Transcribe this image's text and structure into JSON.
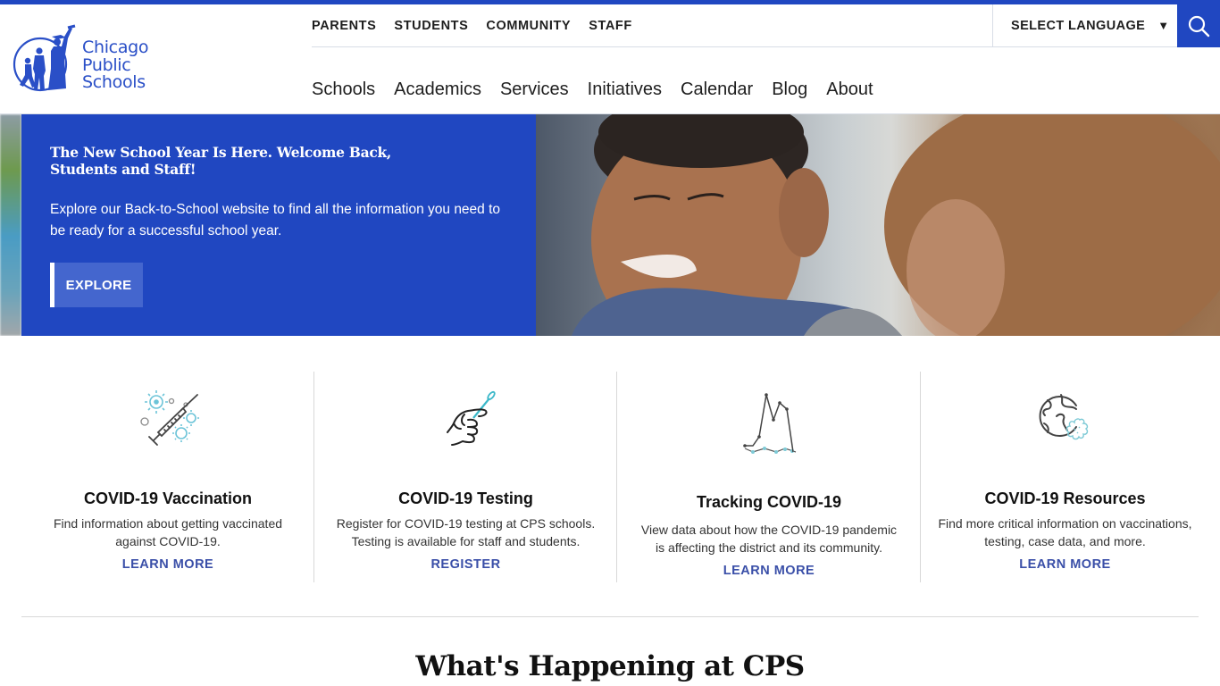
{
  "brand": {
    "name_lines": [
      "Chicago",
      "Public",
      "Schools"
    ],
    "accent_color": "#2047c1"
  },
  "utility_nav": {
    "items": [
      {
        "label": "PARENTS"
      },
      {
        "label": "STUDENTS"
      },
      {
        "label": "COMMUNITY"
      },
      {
        "label": "STAFF"
      }
    ]
  },
  "language": {
    "label": "SELECT LANGUAGE",
    "caret": "▼"
  },
  "search": {
    "icon": "search-icon"
  },
  "main_nav": {
    "items": [
      {
        "label": "Schools"
      },
      {
        "label": "Academics"
      },
      {
        "label": "Services"
      },
      {
        "label": "Initiatives"
      },
      {
        "label": "Calendar"
      },
      {
        "label": "Blog"
      },
      {
        "label": "About"
      }
    ]
  },
  "hero": {
    "title": "The New School Year Is Here. Welcome Back, Students and Staff!",
    "body": "Explore our Back-to-School website to find all the information you need to be ready for a successful school year.",
    "button_label": "EXPLORE",
    "image_alt": "Smiling child looking down beside an adult with curly hair"
  },
  "cards": [
    {
      "icon": "syringe-virus-icon",
      "title": "COVID-19 Vaccination",
      "description": "Find information about getting vaccinated against COVID-19.",
      "link_label": "LEARN MORE"
    },
    {
      "icon": "swab-test-icon",
      "title": "COVID-19 Testing",
      "description": "Register for COVID-19 testing at CPS schools. Testing is available for staff and students.",
      "link_label": "REGISTER"
    },
    {
      "icon": "line-graph-icon",
      "title": "Tracking COVID-19",
      "description": "View data about how the COVID-19 pandemic is affecting the district and its community.",
      "link_label": "LEARN MORE"
    },
    {
      "icon": "globe-virus-icon",
      "title": "COVID-19 Resources",
      "description": "Find more critical information on vaccinations, testing, case data, and more.",
      "link_label": "LEARN MORE"
    }
  ],
  "section": {
    "title": "What's Happening at CPS"
  }
}
